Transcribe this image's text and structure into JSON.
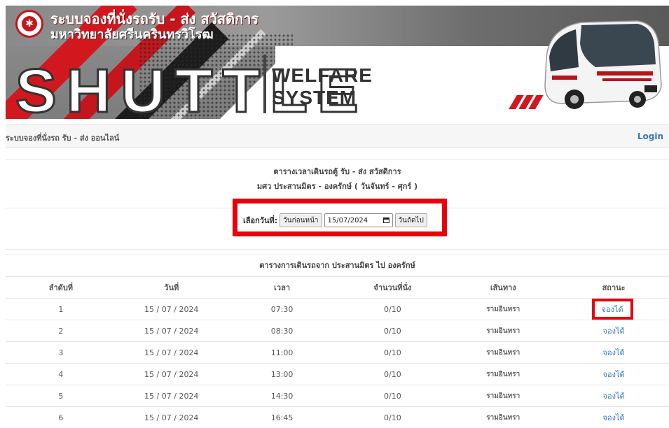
{
  "header": {
    "title_line1": "ระบบจองที่นั่งรถรับ - ส่ง สวัสดิการ",
    "title_line2": "มหาวิทยาลัยศรีนครินทรวิโรฒ",
    "shuttle": "SHUTTLE",
    "welfare": "WELFARE",
    "system": "SYSTEM",
    "accent_color": "#d2171e"
  },
  "navbar": {
    "brand": "ระบบจองที่นั่งรถ รับ - ส่ง ออนไลน์",
    "login": "Login"
  },
  "schedule": {
    "title": "ตารางเวลาเดินรถตู้ รับ - ส่ง สวัสดิการ",
    "subtitle": "มศว ประสานมิตร - องครักษ์ ( วันจันทร์ - ศุกร์ )"
  },
  "date_picker": {
    "label": "เลือกวันที่:",
    "prev_button": "วันก่อนหน้า",
    "date_value": "15/07/2024",
    "next_button": "วันถัดไป"
  },
  "table": {
    "caption": "ตารางการเดินรถจาก ประสานมิตร ไป องครักษ์",
    "headers": [
      "ลำดับที่",
      "วันที่",
      "เวลา",
      "จำนวนที่นั่ง",
      "เส้นทาง",
      "สถานะ"
    ],
    "rows": [
      {
        "no": "1",
        "date": "15 / 07 / 2024",
        "time": "07:30",
        "seats": "0/10",
        "route": "รามอินทรา",
        "status": "จองได้"
      },
      {
        "no": "2",
        "date": "15 / 07 / 2024",
        "time": "08:30",
        "seats": "0/10",
        "route": "รามอินทรา",
        "status": "จองได้"
      },
      {
        "no": "3",
        "date": "15 / 07 / 2024",
        "time": "11:00",
        "seats": "0/10",
        "route": "รามอินทรา",
        "status": "จองได้"
      },
      {
        "no": "4",
        "date": "15 / 07 / 2024",
        "time": "13:00",
        "seats": "0/10",
        "route": "รามอินทรา",
        "status": "จองได้"
      },
      {
        "no": "5",
        "date": "15 / 07 / 2024",
        "time": "14:30",
        "seats": "0/10",
        "route": "รามอินทรา",
        "status": "จองได้"
      },
      {
        "no": "6",
        "date": "15 / 07 / 2024",
        "time": "16:45",
        "seats": "0/10",
        "route": "รามอินทรา",
        "status": "จองได้"
      }
    ]
  }
}
